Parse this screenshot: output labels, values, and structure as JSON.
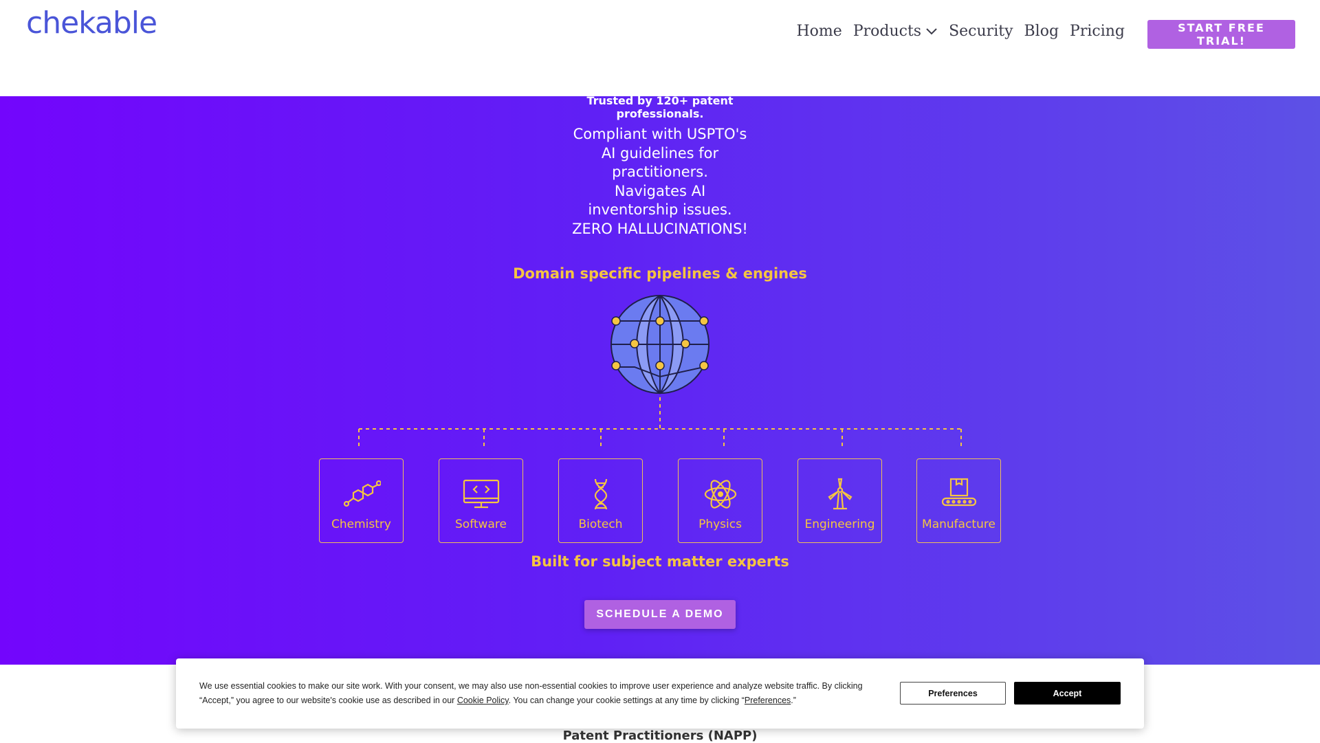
{
  "header": {
    "logo": "chekable",
    "nav": [
      {
        "label": "Home"
      },
      {
        "label": "Products"
      },
      {
        "label": "Security"
      },
      {
        "label": "Blog"
      },
      {
        "label": "Pricing"
      }
    ],
    "cta": "START FREE TRIAL!"
  },
  "hero": {
    "trusted": "Trusted by 120+ patent professionals.",
    "compliant_lines": [
      "Compliant with USPTO's",
      "AI guidelines for",
      "practitioners.",
      "Navigates AI",
      "inventorship issues.",
      "ZERO HALLUCINATIONS!"
    ],
    "domain_title": "Domain specific pipelines & engines",
    "domains": [
      {
        "label": "Chemistry",
        "icon": "molecule-icon"
      },
      {
        "label": "Software",
        "icon": "code-monitor-icon"
      },
      {
        "label": "Biotech",
        "icon": "dna-icon"
      },
      {
        "label": "Physics",
        "icon": "atom-icon"
      },
      {
        "label": "Engineering",
        "icon": "wind-turbine-icon"
      },
      {
        "label": "Manufacture",
        "icon": "conveyor-box-icon"
      }
    ],
    "built_title": "Built for subject matter experts",
    "demo_button": "SCHEDULE A DEMO"
  },
  "cookie": {
    "text_part1": "We use essential cookies to make our site work. With your consent, we may also use non-essential cookies to improve user experience and analyze website traffic. By clicking “Accept,” you agree to our website's cookie use as described in our ",
    "cookie_policy_link": "Cookie Policy",
    "text_part2": ". You can change your cookie settings at any time by clicking “",
    "preferences_link": "Preferences",
    "text_part3": ".”",
    "preferences_button": "Preferences",
    "accept_button": "Accept"
  },
  "below": {
    "napp": "Patent Practitioners (NAPP)"
  },
  "colors": {
    "accent_gold": "#f5c542",
    "button_purple": "#b061e2",
    "logo_blue": "#4a55d8",
    "hero_start": "#7305fc",
    "hero_end": "#5d51e6"
  }
}
